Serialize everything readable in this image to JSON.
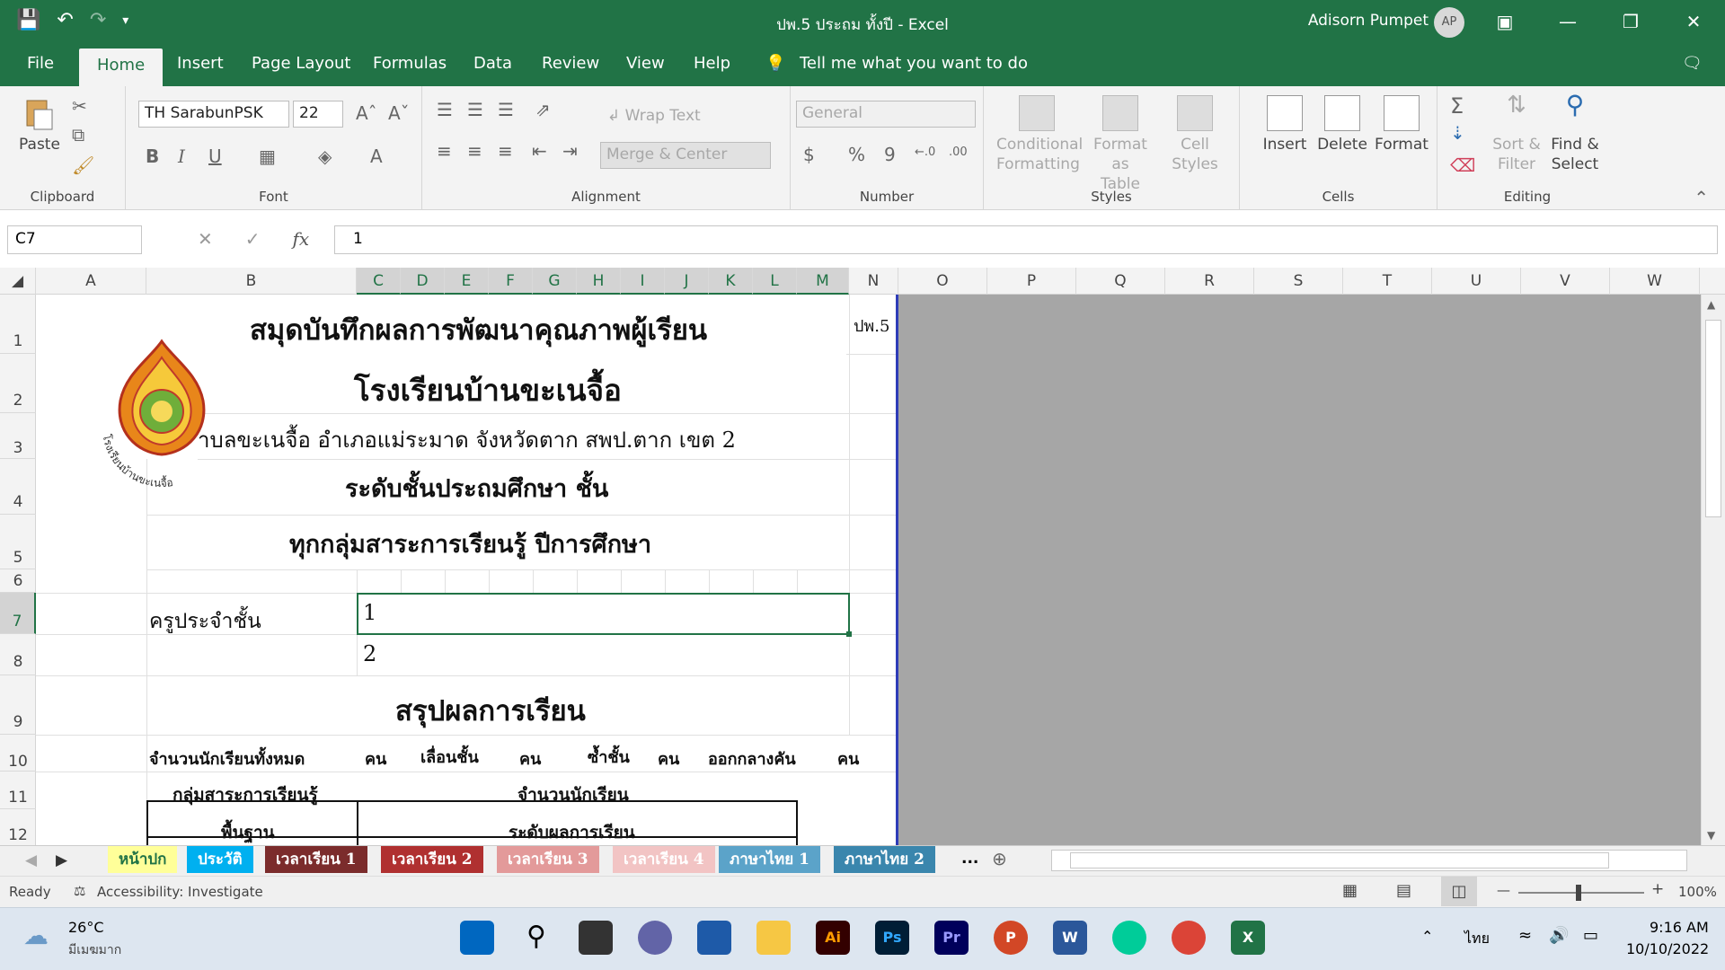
{
  "window": {
    "title": "ปพ.5 ประถม ทั้งปี  -  Excel",
    "user": "Adisorn Pumpet",
    "avatar_initials": "AP"
  },
  "tabs": [
    "File",
    "Home",
    "Insert",
    "Page Layout",
    "Formulas",
    "Data",
    "Review",
    "View",
    "Help"
  ],
  "tell_me": "Tell me what you want to do",
  "ribbon": {
    "clipboard": {
      "label": "Clipboard",
      "paste": "Paste"
    },
    "font": {
      "label": "Font",
      "name": "TH SarabunPSK",
      "size": "22",
      "bold": "B",
      "italic": "I",
      "underline": "U"
    },
    "alignment": {
      "label": "Alignment",
      "wrap": "Wrap Text",
      "merge": "Merge & Center"
    },
    "number": {
      "label": "Number",
      "format": "General",
      "currency": "$",
      "percent": "%",
      "comma": "9"
    },
    "styles": {
      "label": "Styles",
      "conditional": [
        "Conditional",
        "Formatting"
      ],
      "format_table": [
        "Format as",
        "Table"
      ],
      "cell_styles": [
        "Cell",
        "Styles"
      ]
    },
    "cells": {
      "label": "Cells",
      "insert": "Insert",
      "delete": "Delete",
      "format": "Format"
    },
    "editing": {
      "label": "Editing",
      "sort": [
        "Sort &",
        "Filter"
      ],
      "find": [
        "Find &",
        "Select"
      ]
    }
  },
  "formula_bar": {
    "name_box": "C7",
    "value": "1"
  },
  "columns": [
    "A",
    "B",
    "C",
    "D",
    "E",
    "F",
    "G",
    "H",
    "I",
    "J",
    "K",
    "L",
    "M",
    "N",
    "O",
    "P",
    "Q",
    "R",
    "S",
    "T",
    "U",
    "V",
    "W"
  ],
  "rows": [
    "1",
    "2",
    "3",
    "4",
    "5",
    "6",
    "7",
    "8",
    "9",
    "10",
    "11",
    "12"
  ],
  "cells": {
    "n1": "ปพ.5",
    "title1": "สมุดบันทึกผลการพัฒนาคุณภาพผู้เรียน",
    "title2": "โรงเรียนบ้านขะเนจื้อ",
    "address": "ำบลขะเนจื้อ  อำเภอแม่ระมาด  จังหวัดตาก  สพป.ตาก เขต  2",
    "level": "ระดับชั้นประถมศึกษา  ชั้น",
    "year": "ทุกกลุ่มสาระการเรียนรู้  ปีการศึกษา",
    "teacher_label": "ครูประจำชั้น",
    "c7": "1",
    "c8": "2",
    "summary": "สรุปผลการเรียน",
    "r10": [
      "จำนวนนักเรียนทั้งหมด",
      "คน",
      "เลื่อนชั้น",
      "คน",
      "ซ้ำชั้น",
      "คน",
      "ออกกลางคัน",
      "คน"
    ],
    "r11_b": "กลุ่มสาระการเรียนรู้",
    "r11_c": "จำนวนนักเรียน",
    "r12_b": "พื้นฐาน",
    "r12_c": "ระดับผลการเรียน"
  },
  "seal_text": "โรงเรียนบ้านขะเนจื้อ",
  "sheet_tabs": [
    {
      "name": "หน้าปก",
      "color": "#ffff99",
      "text": "#217346"
    },
    {
      "name": "ประวัติ",
      "color": "#00b0f0",
      "text": "#ffffff"
    },
    {
      "name": "เวลาเรียน 1",
      "color": "#7b2c2c",
      "text": "#ffffff"
    },
    {
      "name": "เวลาเรียน 2",
      "color": "#b03030",
      "text": "#ffffff"
    },
    {
      "name": "เวลาเรียน 3",
      "color": "#e39a9a",
      "text": "#ffffff"
    },
    {
      "name": "เวลาเรียน 4",
      "color": "#f2c4c4",
      "text": "#ffffff"
    },
    {
      "name": "ภาษาไทย 1",
      "color": "#5ba3c9",
      "text": "#ffffff"
    },
    {
      "name": "ภาษาไทย 2",
      "color": "#3a86ad",
      "text": "#ffffff"
    }
  ],
  "status": {
    "ready": "Ready",
    "accessibility": "Accessibility: Investigate",
    "zoom": "100%"
  },
  "taskbar": {
    "temp": "26°C",
    "weather": "มีเมฆมาก",
    "lang": "ไทย",
    "time": "9:16 AM",
    "date": "10/10/2022"
  }
}
